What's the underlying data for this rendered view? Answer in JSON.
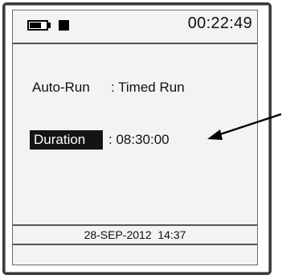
{
  "status_bar": {
    "battery_icon": "battery-icon",
    "battery_level": 0.7,
    "record_icon": "stop-square-icon",
    "time": "00:22:49"
  },
  "settings": {
    "auto_run_label": "Auto-Run",
    "auto_run_value": ": Timed Run",
    "duration_label": "Duration",
    "duration_value": ": 08:30:00"
  },
  "footer": {
    "datetime": "28-SEP-2012  14:37"
  },
  "annotation": {
    "arrow_icon": "pointer-arrow-icon"
  },
  "colors": {
    "screen_bg": "#f3f3f3",
    "highlight_bg": "#141414",
    "text": "#111111"
  }
}
